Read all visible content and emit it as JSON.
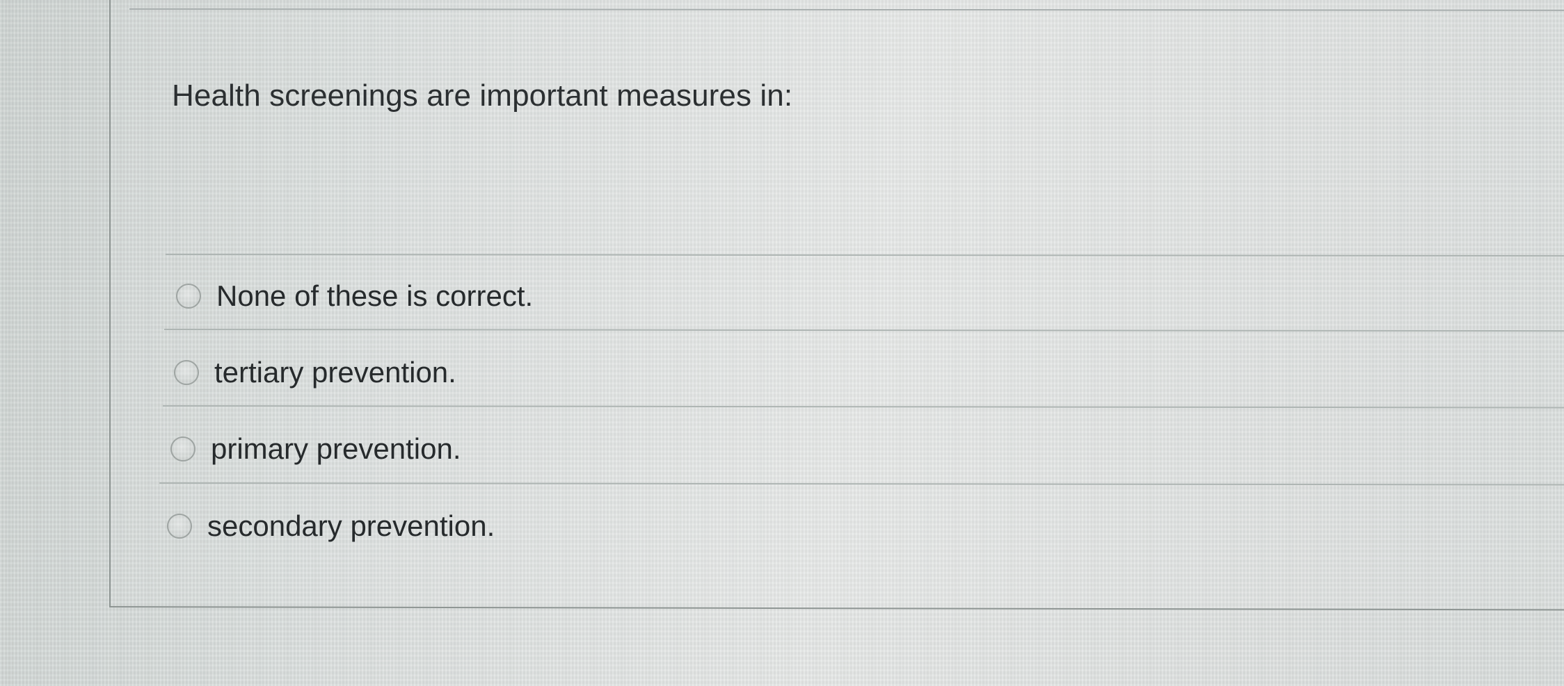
{
  "question": {
    "text": "Health screenings are important measures in:"
  },
  "answers": [
    {
      "label": "None of these is correct.",
      "selected": false
    },
    {
      "label": "tertiary prevention.",
      "selected": false
    },
    {
      "label": "primary prevention.",
      "selected": false
    },
    {
      "label": "secondary prevention.",
      "selected": false
    }
  ]
}
